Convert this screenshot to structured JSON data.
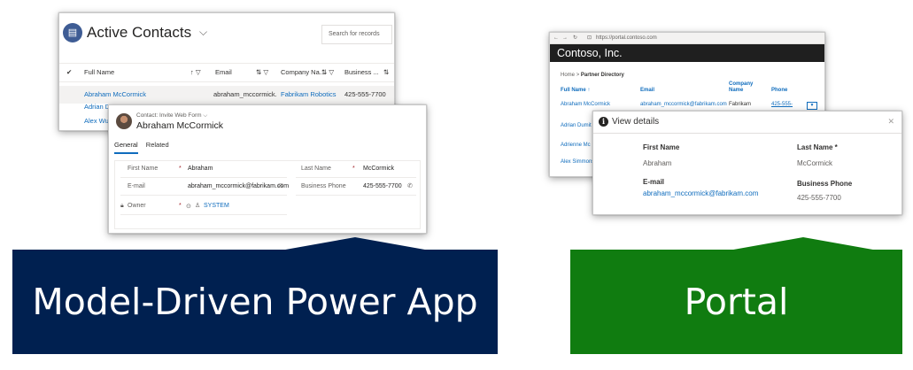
{
  "model_driven": {
    "list": {
      "entity_icon": "contact-entity-icon",
      "view_title": "Active Contacts",
      "search_placeholder": "Search for records",
      "columns": [
        "Full Name",
        "Email",
        "Company Na...",
        "Business ..."
      ],
      "rows": [
        {
          "full_name": "Abraham McCormick",
          "email": "abraham_mccormick...",
          "company": "Fabrikam Robotics",
          "phone": "425-555-7700"
        },
        {
          "full_name": "Adrian D",
          "email": "",
          "company": "",
          "phone": ""
        },
        {
          "full_name": "Alex Wu",
          "email": "",
          "company": "",
          "phone": ""
        }
      ]
    },
    "form": {
      "form_label": "Contact: Invite Web Form",
      "record_name": "Abraham McCormick",
      "tabs": [
        "General",
        "Related"
      ],
      "fields": {
        "first_name_label": "First Name",
        "first_name_value": "Abraham",
        "last_name_label": "Last Name",
        "last_name_value": "McCormick",
        "email_label": "E-mail",
        "email_value": "abraham_mccormick@fabrikam.com",
        "business_phone_label": "Business Phone",
        "business_phone_value": "425-555-7700",
        "owner_label": "Owner",
        "owner_value": "SYSTEM"
      }
    }
  },
  "portal": {
    "browser": {
      "url": "https://portal.contoso.com",
      "site_title": "Contoso, Inc.",
      "breadcrumb_home": "Home",
      "breadcrumb_current": "Partner Directory",
      "columns": [
        "Full Name",
        "Email",
        "Company Name",
        "Phone"
      ],
      "rows": [
        {
          "full_name": "Abraham McCormick",
          "email": "abraham_mccormick@fabrikam.com",
          "company": "Fabrikam",
          "phone": "425-555-"
        },
        {
          "full_name": "Adrian Dumit"
        },
        {
          "full_name": "Adrienne Mc"
        },
        {
          "full_name": "Alex Simmons"
        }
      ]
    },
    "modal": {
      "title": "View details",
      "first_name_label": "First Name",
      "first_name_value": "Abraham",
      "last_name_label": "Last Name *",
      "last_name_value": "McCormick",
      "email_label": "E-mail",
      "email_value": "abraham_mccormick@fabrikam.com",
      "business_phone_label": "Business Phone",
      "business_phone_value": "425-555-7700"
    }
  },
  "captions": {
    "model_driven": "Model-Driven Power App",
    "portal": "Portal"
  },
  "colors": {
    "model_driven_caption": "#002050",
    "portal_caption": "#107c10",
    "link": "#0f6cbd"
  }
}
